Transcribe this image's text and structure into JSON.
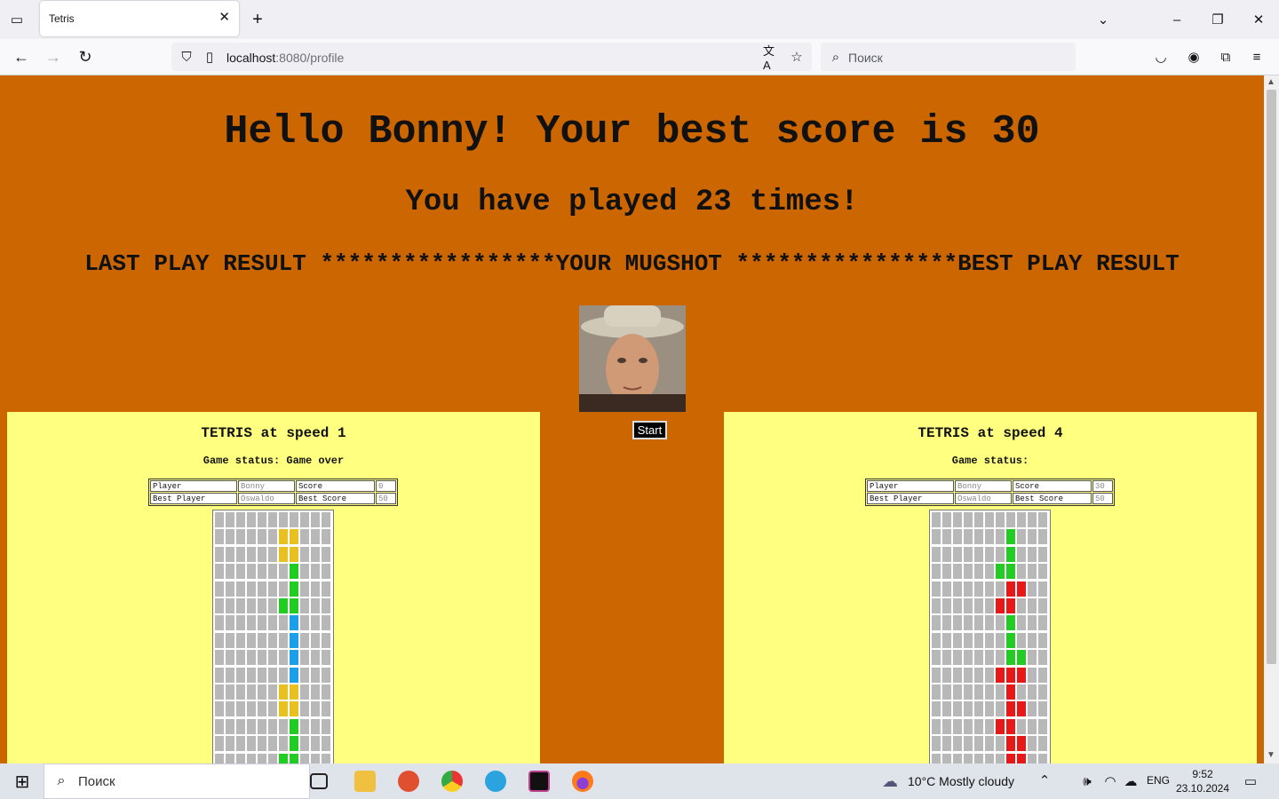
{
  "browser": {
    "tab_title": "Tetris",
    "url_host": "localhost",
    "url_path": ":8080/profile",
    "search_placeholder": "Поиск"
  },
  "page": {
    "greeting": "Hello Bonny! Your best score is 30",
    "played": "You have played 23 times!",
    "banner": "LAST PLAY RESULT *****************YOUR MUGSHOT ****************BEST PLAY RESULT",
    "start_label": "Start"
  },
  "last_game": {
    "title": "TETRIS at speed 1",
    "status": "Game status: Game over",
    "player_label": "Player",
    "player": "Bonny",
    "score_label": "Score",
    "score": "0",
    "best_player_label": "Best Player",
    "best_player": "Oswaldo",
    "best_score_label": "Best Score",
    "best_score": "50",
    "rows": [
      ".........",
      "....yy.",
      "....yy.",
      ".....g.",
      ".....g.",
      "....gg.",
      ".....b.",
      ".....b.",
      ".....b.",
      ".....b.",
      "....yy.",
      "....yy.",
      ".....g.",
      ".....g.",
      "....gg."
    ]
  },
  "best_game": {
    "title": "TETRIS at speed 4",
    "status": "Game status:",
    "player_label": "Player",
    "player": "Bonny",
    "score_label": "Score",
    "score": "30",
    "best_player_label": "Best Player",
    "best_player": "Oswaldo",
    "best_score_label": "Best Score",
    "best_score": "50",
    "rows": [
      ".........",
      ".....g.",
      ".....g.",
      "....gg.",
      ".....rr",
      "....rr.",
      ".....g.",
      ".....g.",
      ".....gg",
      "....rrr",
      ".....r.",
      ".....rr",
      "....rr.",
      ".....rr",
      ".....rr"
    ]
  },
  "colors": {
    "y": "#e8c020",
    "g": "#22cc22",
    "b": "#1a9fe8",
    "r": "#e81818",
    "empty": "#b8b8b8"
  },
  "taskbar": {
    "search": "Поиск",
    "weather": "10°C  Mostly cloudy",
    "lang": "ENG",
    "time": "9:52",
    "date": "23.10.2024"
  }
}
